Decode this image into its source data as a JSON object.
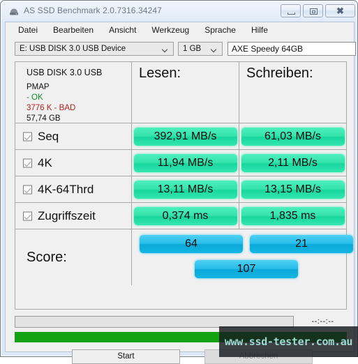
{
  "window": {
    "title": "AS SSD Benchmark 2.0.7316.34247",
    "icon": "drive-icon",
    "controls": {
      "minimize": "minimize-icon",
      "restore": "restore-icon",
      "close": "close-icon"
    }
  },
  "menu": {
    "items": [
      {
        "label": "Datei"
      },
      {
        "label": "Bearbeiten"
      },
      {
        "label": "Ansicht"
      },
      {
        "label": "Werkzeug"
      },
      {
        "label": "Sprache"
      },
      {
        "label": "Hilfe"
      }
    ]
  },
  "selector": {
    "device": "E: USB DISK 3.0 USB Device",
    "size": "1 GB",
    "name_value": "AXE Speedy 64GB",
    "name_placeholder": "AXE Speedy 64GB"
  },
  "device_info": {
    "model": "USB DISK 3.0 USB",
    "firmware": "PMAP",
    "alignment": "- OK",
    "offset": "3776 K - BAD",
    "capacity": "57,74 GB"
  },
  "columns": {
    "read": "Lesen:",
    "write": "Schreiben:"
  },
  "rows": [
    {
      "label": "Seq",
      "checked": true,
      "read": "392,91 MB/s",
      "write": "61,03 MB/s"
    },
    {
      "label": "4K",
      "checked": true,
      "read": "11,94 MB/s",
      "write": "2,11 MB/s"
    },
    {
      "label": "4K-64Thrd",
      "checked": true,
      "read": "13,11 MB/s",
      "write": "13,15 MB/s"
    },
    {
      "label": "Zugriffszeit",
      "checked": true,
      "read": "0,374 ms",
      "write": "1,835 ms"
    }
  ],
  "score": {
    "label": "Score:",
    "read": "64",
    "write": "21",
    "total": "107"
  },
  "status": {
    "message": "",
    "timer": "--:--:--",
    "progress_percent": 100
  },
  "buttons": {
    "start": "Start",
    "cancel": "Abbrechen"
  },
  "watermark": {
    "text": "www.ssd-tester.com.au"
  },
  "colors": {
    "bar_green": "#2fe5ab",
    "bar_blue": "#1bb8e4",
    "progress_green": "#13a312",
    "status_ok": "#138a2e",
    "status_bad": "#b22222"
  }
}
